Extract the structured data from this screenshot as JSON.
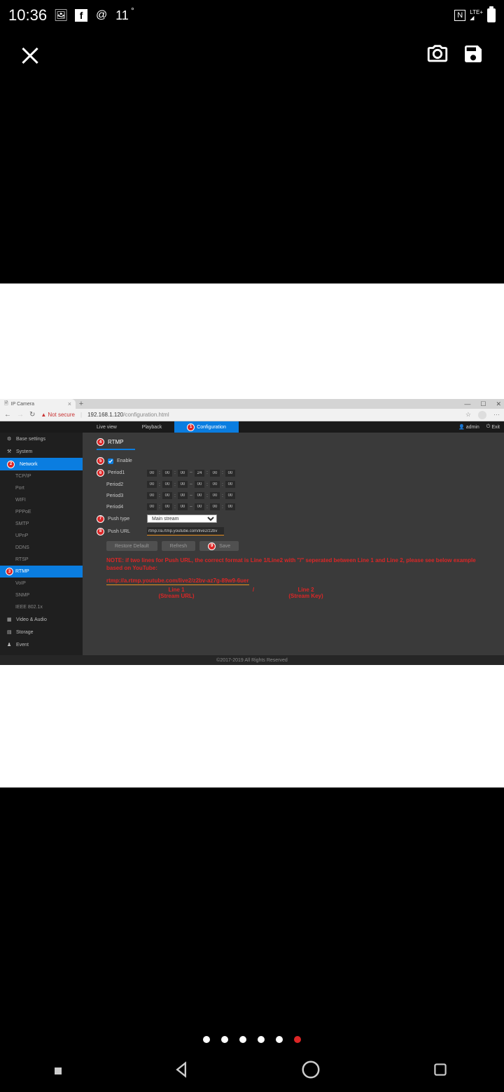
{
  "status": {
    "time": "10:36",
    "temp": "11",
    "lte": "LTE+"
  },
  "browser": {
    "tab_title": "IP Camera",
    "not_secure": "Not secure",
    "url_host": "192.168.1.120",
    "url_path": "/configuration.html"
  },
  "topnav": {
    "live": "Live view",
    "playback": "Playback",
    "config": "Configuration",
    "user": "admin",
    "exit": "Exit"
  },
  "sidebar": {
    "base": "Base settings",
    "system": "System",
    "network": "Network",
    "subs": [
      "TCP/IP",
      "Port",
      "WIFI",
      "PPPoE",
      "SMTP",
      "UPnP",
      "DDNS",
      "RTSP",
      "RTMP",
      "VoIP",
      "SNMP",
      "IEEE 802.1x"
    ],
    "video": "Video & Audio",
    "storage": "Storage",
    "event": "Event"
  },
  "rtmp": {
    "title": "RTMP",
    "enable": "Enable",
    "periods": [
      "Period1",
      "Period2",
      "Period3",
      "Period4"
    ],
    "period_vals": [
      {
        "s": [
          "00",
          "00",
          "00"
        ],
        "e": [
          "24",
          "00",
          "00"
        ]
      },
      {
        "s": [
          "00",
          "00",
          "00"
        ],
        "e": [
          "00",
          "00",
          "00"
        ]
      },
      {
        "s": [
          "00",
          "00",
          "00"
        ],
        "e": [
          "00",
          "00",
          "00"
        ]
      },
      {
        "s": [
          "00",
          "00",
          "00"
        ],
        "e": [
          "00",
          "00",
          "00"
        ]
      }
    ],
    "push_type": "Push type",
    "push_type_val": "Main stream",
    "push_url": "Push URL",
    "push_url_val": "rtmp://a.rtmp.youtube.com/live2/z2bv",
    "restore": "Restore Default",
    "refresh": "Refresh",
    "save": "Save",
    "note": "NOTE: if two lines for Push URL, the correct format is Line 1/Line2 with \"/\" seperated between Line 1 and Line 2, please see below example based on YouTube:",
    "example": "rtmp://a.rtmp.youtube.com/live2/z2bv-az7g-89w9-6uer",
    "line1": "Line 1",
    "line2": "Line 2",
    "stream_url": "(Stream URL)",
    "stream_key": "(Stream Key)"
  },
  "footer": "©2017-2019 All Rights Reserved",
  "callouts": [
    "1",
    "2",
    "3",
    "4",
    "5",
    "6",
    "7",
    "8",
    "9"
  ]
}
